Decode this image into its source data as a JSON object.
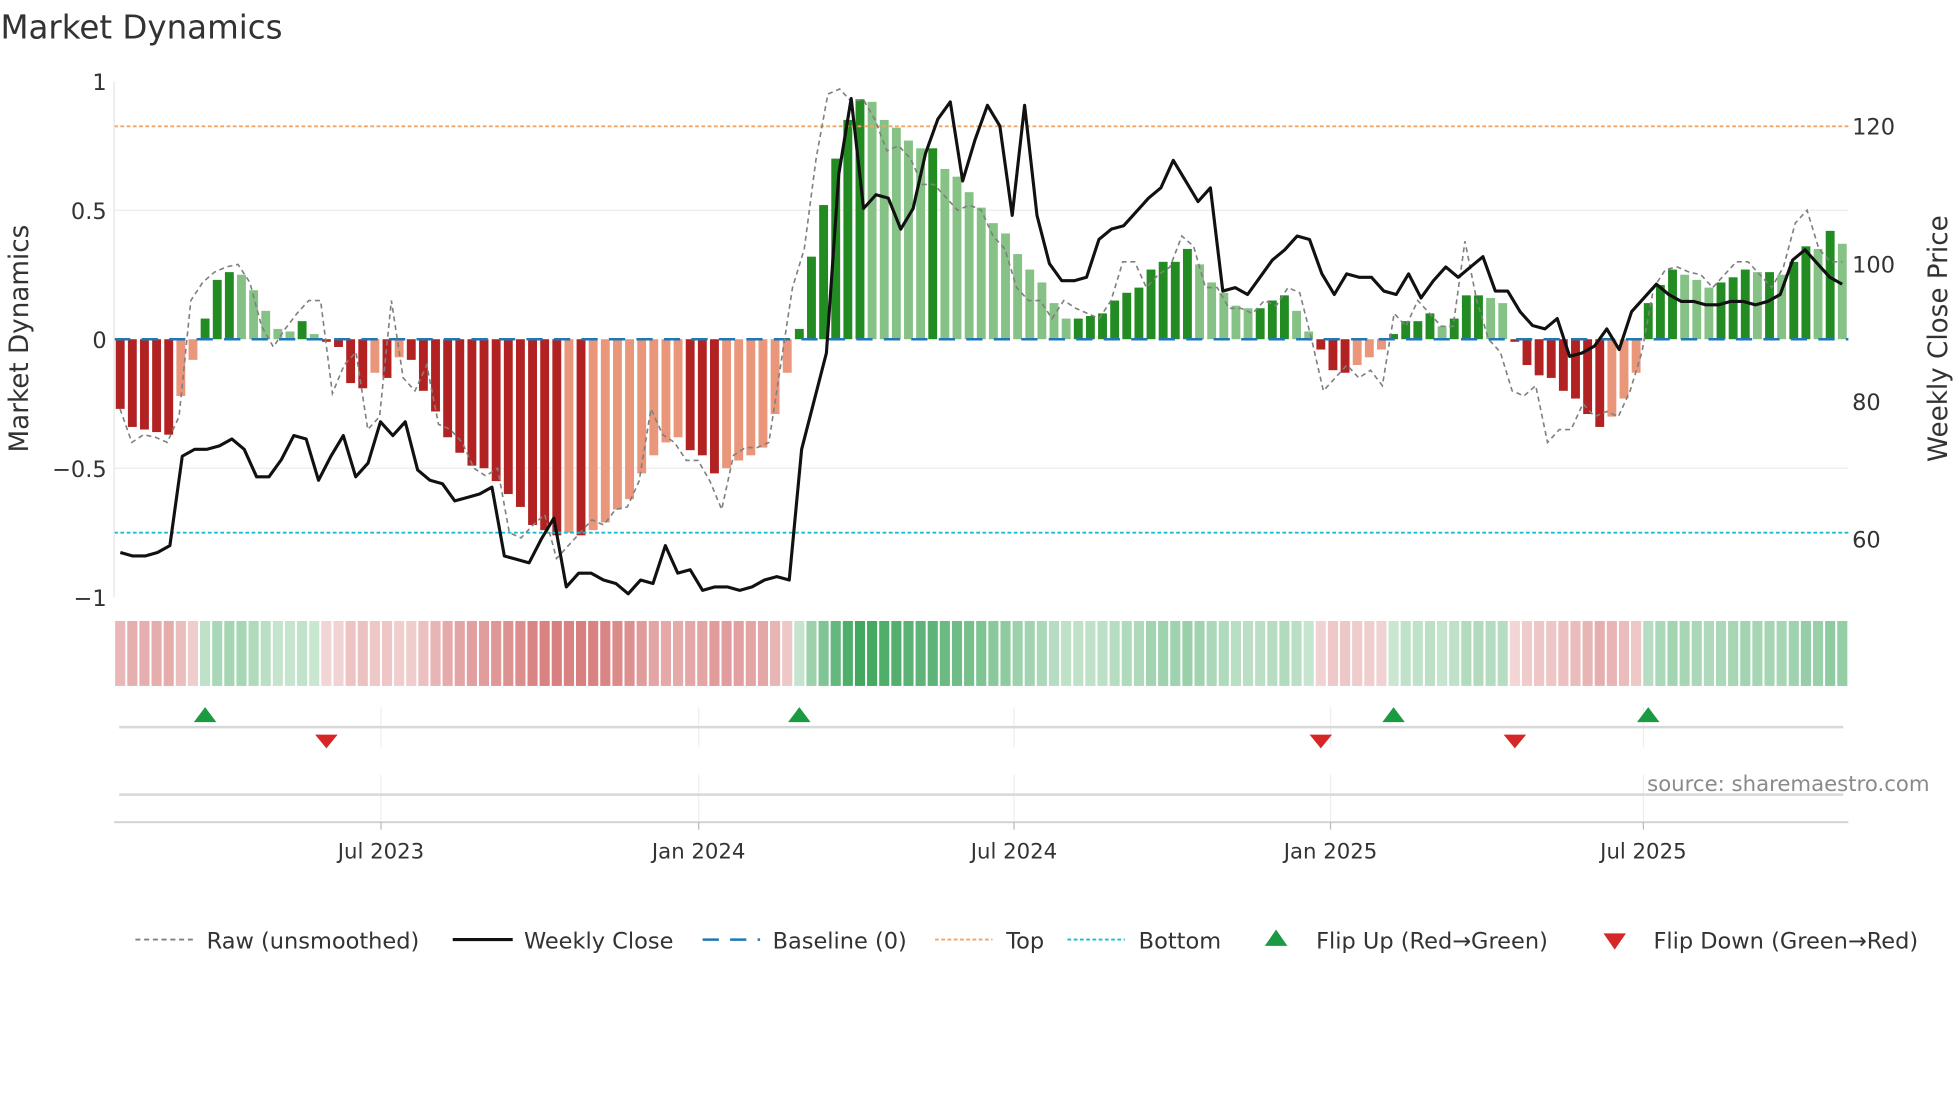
{
  "chart_data": {
    "type": "bar",
    "title": "Market Dynamics",
    "ylabel": "Market Dynamics",
    "y2label": "Weekly Close Price",
    "ylim": [
      -1,
      1
    ],
    "y2lim": [
      51.5,
      126.5
    ],
    "yticks": [
      {
        "v": 1,
        "label": "1"
      },
      {
        "v": 0.5,
        "label": "0.5"
      },
      {
        "v": 0,
        "label": "0"
      },
      {
        "v": -0.5,
        "label": "−0.5"
      },
      {
        "v": -1,
        "label": "−1"
      }
    ],
    "y2ticks": [
      {
        "v": 60,
        "label": "60"
      },
      {
        "v": 80,
        "label": "80"
      },
      {
        "v": 100,
        "label": "100"
      },
      {
        "v": 120,
        "label": "120"
      }
    ],
    "xticks": [
      {
        "week": 22.0,
        "label": "Jul 2023"
      },
      {
        "week": 48.2,
        "label": "Jan 2024"
      },
      {
        "week": 74.2,
        "label": "Jul 2024"
      },
      {
        "week": 100.3,
        "label": "Jan 2025"
      },
      {
        "week": 126.1,
        "label": "Jul 2025"
      }
    ],
    "top_level": 0.825,
    "bottom_level": -0.75,
    "baseline": 0,
    "smoothed": [
      -0.27,
      -0.34,
      -0.35,
      -0.36,
      -0.37,
      -0.22,
      -0.08,
      0.08,
      0.23,
      0.26,
      0.25,
      0.19,
      0.11,
      0.04,
      0.03,
      0.07,
      0.02,
      -0.01,
      -0.03,
      -0.17,
      -0.19,
      -0.13,
      -0.15,
      -0.07,
      -0.08,
      -0.2,
      -0.28,
      -0.38,
      -0.44,
      -0.49,
      -0.5,
      -0.55,
      -0.6,
      -0.65,
      -0.72,
      -0.74,
      -0.76,
      -0.75,
      -0.76,
      -0.74,
      -0.71,
      -0.66,
      -0.62,
      -0.52,
      -0.45,
      -0.4,
      -0.38,
      -0.43,
      -0.45,
      -0.52,
      -0.5,
      -0.47,
      -0.45,
      -0.42,
      -0.29,
      -0.13,
      0.04,
      0.32,
      0.52,
      0.7,
      0.85,
      0.93,
      0.92,
      0.85,
      0.82,
      0.77,
      0.74,
      0.74,
      0.66,
      0.63,
      0.57,
      0.51,
      0.45,
      0.41,
      0.33,
      0.27,
      0.22,
      0.14,
      0.08,
      0.08,
      0.09,
      0.1,
      0.15,
      0.18,
      0.2,
      0.27,
      0.3,
      0.3,
      0.35,
      0.29,
      0.22,
      0.18,
      0.13,
      0.12,
      0.12,
      0.15,
      0.17,
      0.11,
      0.03,
      -0.04,
      -0.12,
      -0.13,
      -0.1,
      -0.07,
      -0.04,
      0.02,
      0.07,
      0.07,
      0.1,
      0.05,
      0.08,
      0.17,
      0.17,
      0.16,
      0.14,
      -0.01,
      -0.1,
      -0.14,
      -0.15,
      -0.2,
      -0.23,
      -0.29,
      -0.34,
      -0.3,
      -0.23,
      -0.13,
      0.14,
      0.21,
      0.27,
      0.25,
      0.23,
      0.2,
      0.22,
      0.24,
      0.27,
      0.26,
      0.26,
      0.25,
      0.3,
      0.36,
      0.35,
      0.42,
      0.37
    ],
    "raw": [
      -0.27,
      -0.4,
      -0.37,
      -0.38,
      -0.4,
      -0.3,
      0.15,
      0.22,
      0.26,
      0.28,
      0.29,
      0.22,
      0.05,
      -0.03,
      0.04,
      0.1,
      0.15,
      0.15,
      -0.21,
      -0.1,
      -0.05,
      -0.35,
      -0.3,
      0.15,
      -0.15,
      -0.2,
      -0.1,
      -0.33,
      -0.35,
      -0.4,
      -0.5,
      -0.53,
      -0.5,
      -0.75,
      -0.77,
      -0.72,
      -0.68,
      -0.85,
      -0.8,
      -0.75,
      -0.7,
      -0.72,
      -0.66,
      -0.65,
      -0.55,
      -0.27,
      -0.37,
      -0.4,
      -0.47,
      -0.47,
      -0.55,
      -0.66,
      -0.45,
      -0.42,
      -0.42,
      -0.4,
      -0.1,
      0.2,
      0.35,
      0.7,
      0.95,
      0.97,
      0.92,
      0.93,
      0.85,
      0.73,
      0.75,
      0.7,
      0.6,
      0.6,
      0.55,
      0.5,
      0.52,
      0.5,
      0.4,
      0.35,
      0.2,
      0.15,
      0.15,
      0.08,
      0.15,
      0.12,
      0.1,
      0.08,
      0.15,
      0.3,
      0.3,
      0.2,
      0.25,
      0.28,
      0.4,
      0.36,
      0.2,
      0.2,
      0.12,
      0.12,
      0.1,
      0.15,
      0.13,
      0.2,
      0.18,
      0.0,
      -0.2,
      -0.15,
      -0.1,
      -0.15,
      -0.12,
      -0.18,
      0.1,
      0.05,
      0.15,
      0.1,
      0.05,
      0.05,
      0.38,
      0.15,
      0.0,
      -0.05,
      -0.2,
      -0.22,
      -0.18,
      -0.4,
      -0.35,
      -0.35,
      -0.25,
      -0.3,
      -0.28,
      -0.3,
      -0.2,
      -0.05,
      0.2,
      0.27,
      0.28,
      0.26,
      0.25,
      0.2,
      0.25,
      0.3,
      0.3,
      0.25,
      0.2,
      0.28,
      0.45,
      0.5,
      0.35,
      0.3,
      0.3
    ],
    "weekly_close": [
      58,
      57.5,
      57.5,
      58,
      59,
      72,
      73,
      73,
      73.5,
      74.5,
      73,
      69,
      69,
      71.5,
      75,
      74.5,
      68.5,
      72,
      75,
      69,
      71,
      77,
      75,
      77,
      70,
      68.5,
      68,
      65.5,
      66,
      66.5,
      67.5,
      57.5,
      57,
      56.5,
      60,
      63,
      53,
      55,
      55,
      54,
      53.5,
      52,
      54,
      53.5,
      59,
      55,
      55.5,
      52.5,
      53,
      53,
      52.5,
      53,
      54,
      54.5,
      54,
      73,
      80,
      87,
      113,
      124,
      108,
      110,
      109.5,
      105,
      108,
      116,
      121,
      123.5,
      112,
      118,
      123,
      120,
      107,
      123,
      107,
      100,
      97.5,
      97.5,
      98,
      103.5,
      105,
      105.5,
      107.5,
      109.5,
      111,
      115,
      112,
      109,
      111,
      96,
      96.5,
      95.5,
      98,
      100.5,
      102,
      104,
      103.5,
      98.5,
      95.5,
      98.5,
      98,
      98,
      96,
      95.5,
      98.5,
      95,
      97.5,
      99.5,
      98,
      99.5,
      101,
      96,
      96,
      93,
      91,
      90.5,
      92,
      86.5,
      87,
      88,
      90.5,
      87.5,
      93,
      95,
      97,
      95.5,
      94.5,
      94.5,
      94,
      94,
      94.5,
      94.5,
      94,
      94.5,
      95.5,
      100.5,
      102,
      100,
      98,
      97
    ],
    "legend": {
      "placement": "bottom",
      "raw": "Raw (unsmoothed)",
      "close": "Weekly Close",
      "baseline": "Baseline (0)",
      "top": "Top",
      "bottom": "Bottom",
      "flip_up": "Flip Up (Red→Green)",
      "flip_down": "Flip Down (Green→Red)"
    },
    "source": "source: sharemaestro.com",
    "colors": {
      "dark_red": "#b22222",
      "light_red": "#e9967a",
      "dark_green": "#228b22",
      "light_green": "#86c286",
      "strip_red": "#cd5c5c",
      "strip_green": "#2e9e4f",
      "flip_up": "#1a9a41",
      "flip_down": "#d62728",
      "top": "#f4a460",
      "bottom": "#17becf",
      "baseline": "#1f77b4",
      "raw": "#808080",
      "close": "#111111"
    }
  }
}
